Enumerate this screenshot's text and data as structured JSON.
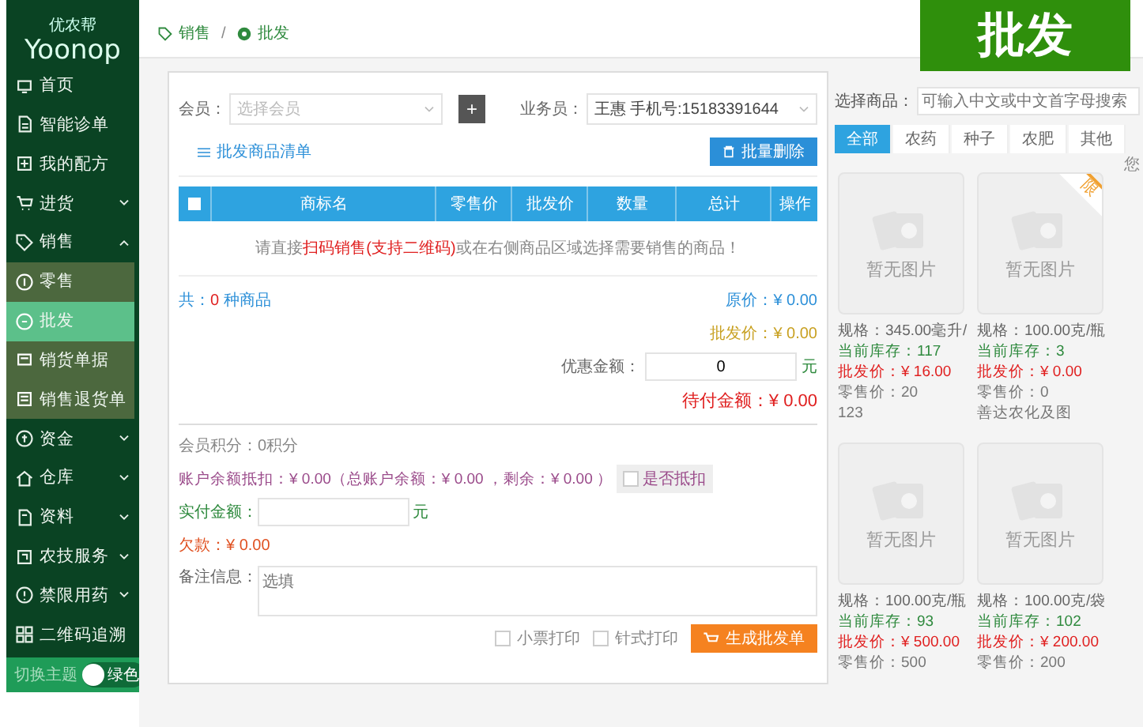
{
  "sidebar": {
    "logo": "Yoonop",
    "logo_sub": "优农帮",
    "items": [
      {
        "label": "首页",
        "expanded": false,
        "has_caret": false,
        "selected": false
      },
      {
        "label": "智能诊单",
        "expanded": false,
        "has_caret": false,
        "selected": false
      },
      {
        "label": "我的配方",
        "expanded": false,
        "has_caret": false,
        "selected": false
      },
      {
        "label": "进货",
        "expanded": false,
        "has_caret": true,
        "selected": false
      },
      {
        "label": "销售",
        "expanded": true,
        "has_caret": true,
        "selected": false,
        "children": [
          {
            "label": "零售",
            "selected": false
          },
          {
            "label": "批发",
            "selected": true
          },
          {
            "label": "销货单据",
            "selected": false
          },
          {
            "label": "销售退货单",
            "selected": false
          }
        ]
      },
      {
        "label": "资金",
        "expanded": false,
        "has_caret": true,
        "selected": false
      },
      {
        "label": "仓库",
        "expanded": false,
        "has_caret": true,
        "selected": false
      },
      {
        "label": "资料",
        "expanded": false,
        "has_caret": true,
        "selected": false
      },
      {
        "label": "农技服务",
        "expanded": false,
        "has_caret": true,
        "selected": false
      },
      {
        "label": "禁限用药",
        "expanded": false,
        "has_caret": true,
        "selected": false
      },
      {
        "label": "二维码追溯",
        "expanded": false,
        "has_caret": false,
        "selected": false
      }
    ],
    "theme": {
      "label": "切换主题",
      "value": "绿色"
    }
  },
  "breadcrumb": [
    "销售",
    "批发"
  ],
  "breadcrumb_separator": "/",
  "corner_badge": "批发",
  "order": {
    "member_label": "会员：",
    "member_placeholder": "选择会员",
    "add": "+",
    "staff_label": "业务员：",
    "staff_value": "王惠 手机号:15183391644",
    "list_title": "批发商品清单",
    "batch_delete": "批量删除",
    "select_all_checked": false,
    "columns": [
      "商标名",
      "零售价",
      "批发价",
      "数量",
      "总计",
      "操作"
    ],
    "empty_parts": [
      "请直接",
      "扫码销售(支持二维码)",
      "或在右侧商品区域选择需要销售的商品！"
    ],
    "count_prefix": "共：",
    "count": "0",
    "count_suffix": "种商品",
    "original_price": "原价：¥ 0.00",
    "wholesale_price": "批发价：¥ 0.00",
    "discount_label": "优惠金额：",
    "discount_value": "0",
    "unit": "元",
    "due": "待付金额：¥ 0.00",
    "points": "会员积分：0积分",
    "balance": "账户余额抵扣：¥ 0.00（总账户余额：¥ 0.00 ，剩余：¥ 0.00 ）",
    "deduct": {
      "label": "是否抵扣",
      "checked": false
    },
    "paid_label": "实付金额：",
    "paid_unit": "元",
    "debt": "欠款：¥ 0.00",
    "note_label": "备注信息：",
    "note_placeholder": "选填",
    "print_options": [
      {
        "label": "小票打印",
        "checked": false
      },
      {
        "label": "针式打印",
        "checked": false
      }
    ],
    "submit": "生成批发单"
  },
  "products": {
    "search_label": "选择商品：",
    "search_placeholder": "可输入中文或中文首字母搜索",
    "tabs": [
      {
        "label": "全部",
        "selected": true
      },
      {
        "label": "农药",
        "selected": false
      },
      {
        "label": "种子",
        "selected": false
      },
      {
        "label": "农肥",
        "selected": false
      },
      {
        "label": "其他",
        "selected": false
      }
    ],
    "hint": "您",
    "items": [
      {
        "no_image": "暂无图片",
        "restricted": false,
        "spec": "规格：345.00毫升/",
        "stock": "当前库存：117",
        "wholesale": "批发价：¥ 16.00",
        "retail": "零售价：20",
        "extra": "123"
      },
      {
        "no_image": "暂无图片",
        "restricted": true,
        "restricted_label": "限",
        "spec": "规格：100.00克/瓶",
        "stock": "当前库存：3",
        "wholesale": "批发价：¥ 0.00",
        "retail": "零售价：0",
        "extra": "善达农化及图"
      },
      {
        "no_image": "暂无图片",
        "restricted": false,
        "spec": "规格：100.00克/瓶",
        "stock": "当前库存：93",
        "wholesale": "批发价：¥ 500.00",
        "retail": "零售价：500"
      },
      {
        "no_image": "暂无图片",
        "restricted": false,
        "spec": "规格：100.00克/袋",
        "stock": "当前库存：102",
        "wholesale": "批发价：¥ 200.00",
        "retail": "零售价：200"
      }
    ]
  }
}
